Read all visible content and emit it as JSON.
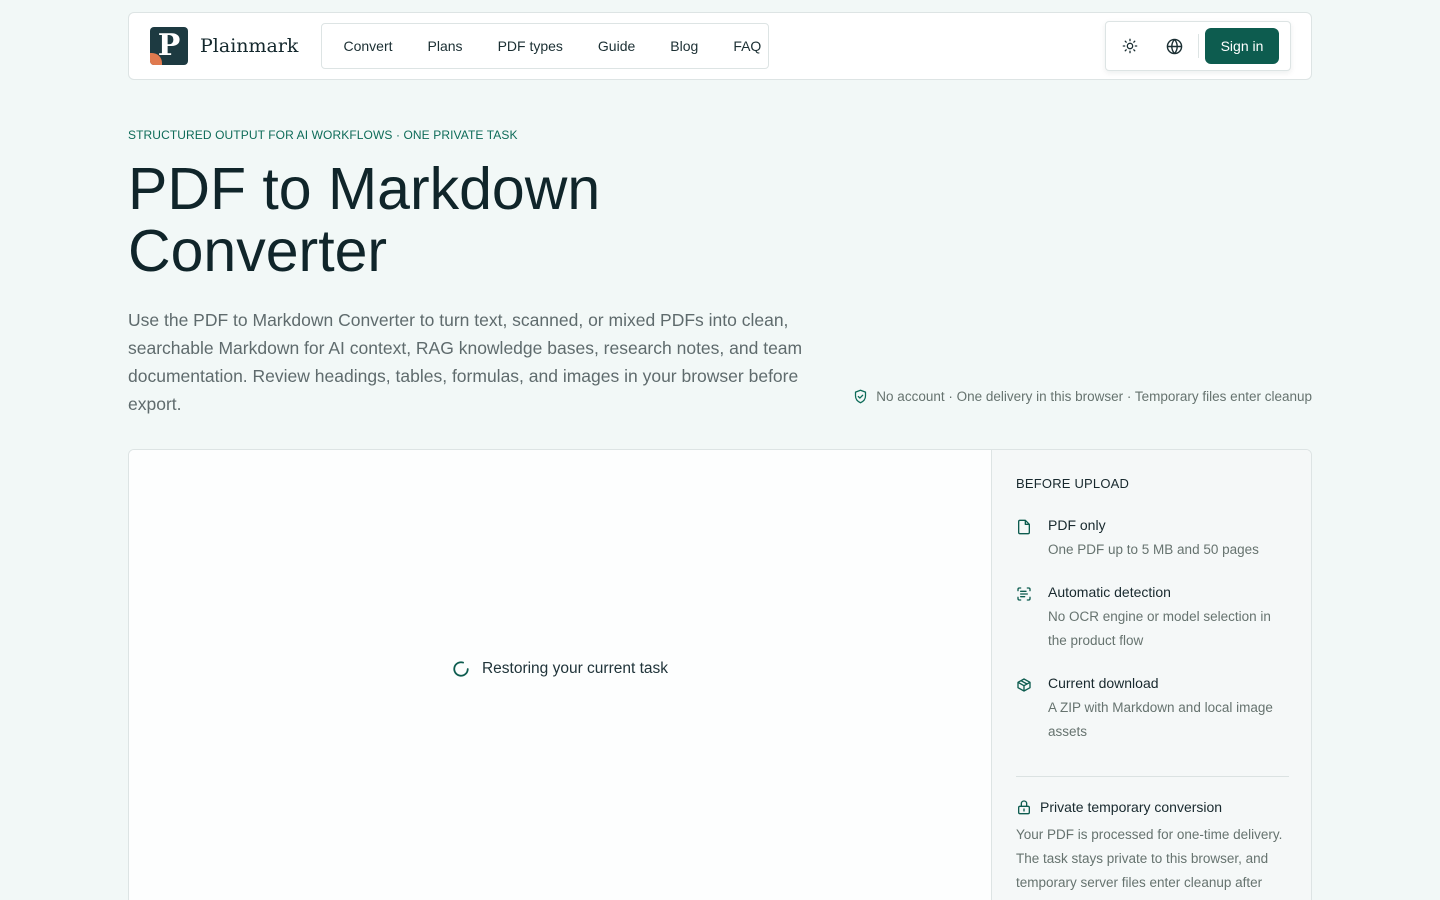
{
  "brand": {
    "name": "Plainmark",
    "logo_letter": "P"
  },
  "nav": {
    "items": [
      {
        "label": "Convert"
      },
      {
        "label": "Plans"
      },
      {
        "label": "PDF types"
      },
      {
        "label": "Guide"
      },
      {
        "label": "Blog"
      },
      {
        "label": "FAQ"
      }
    ]
  },
  "actions": {
    "theme_icon": "sun-icon",
    "language_icon": "globe-icon",
    "sign_in_label": "Sign in"
  },
  "hero": {
    "eyebrow": "STRUCTURED OUTPUT FOR AI WORKFLOWS · ONE PRIVATE TASK",
    "title_line1": "PDF to Markdown",
    "title_line2": "Converter",
    "lead": "Use the PDF to Markdown Converter to turn text, scanned, or mixed PDFs into clean, searchable Markdown for AI context, RAG knowledge bases, research notes, and team documentation. Review headings, tables, formulas, and images in your browser before export.",
    "privacy_note": "No account · One delivery in this browser · Temporary files enter cleanup"
  },
  "converter": {
    "loading_text": "Restoring your current task"
  },
  "sidebar": {
    "heading": "BEFORE UPLOAD",
    "requirements": [
      {
        "icon": "file-icon",
        "title": "PDF only",
        "desc": "One PDF up to 5 MB and 50 pages"
      },
      {
        "icon": "scan-text-icon",
        "title": "Automatic detection",
        "desc": "No OCR engine or model selection in the product flow"
      },
      {
        "icon": "package-icon",
        "title": "Current download",
        "desc": "A ZIP with Markdown and local image assets"
      }
    ],
    "private": {
      "icon": "lock-icon",
      "title": "Private temporary conversion",
      "desc": "Your PDF is processed for one-time delivery. The task stays private to this browser, and temporary server files enter cleanup after"
    }
  },
  "colors": {
    "accent": "#0d5c4f",
    "eyebrow": "#0d6b58",
    "background": "#f2f8f7",
    "logo_accent": "#e07a4f"
  }
}
